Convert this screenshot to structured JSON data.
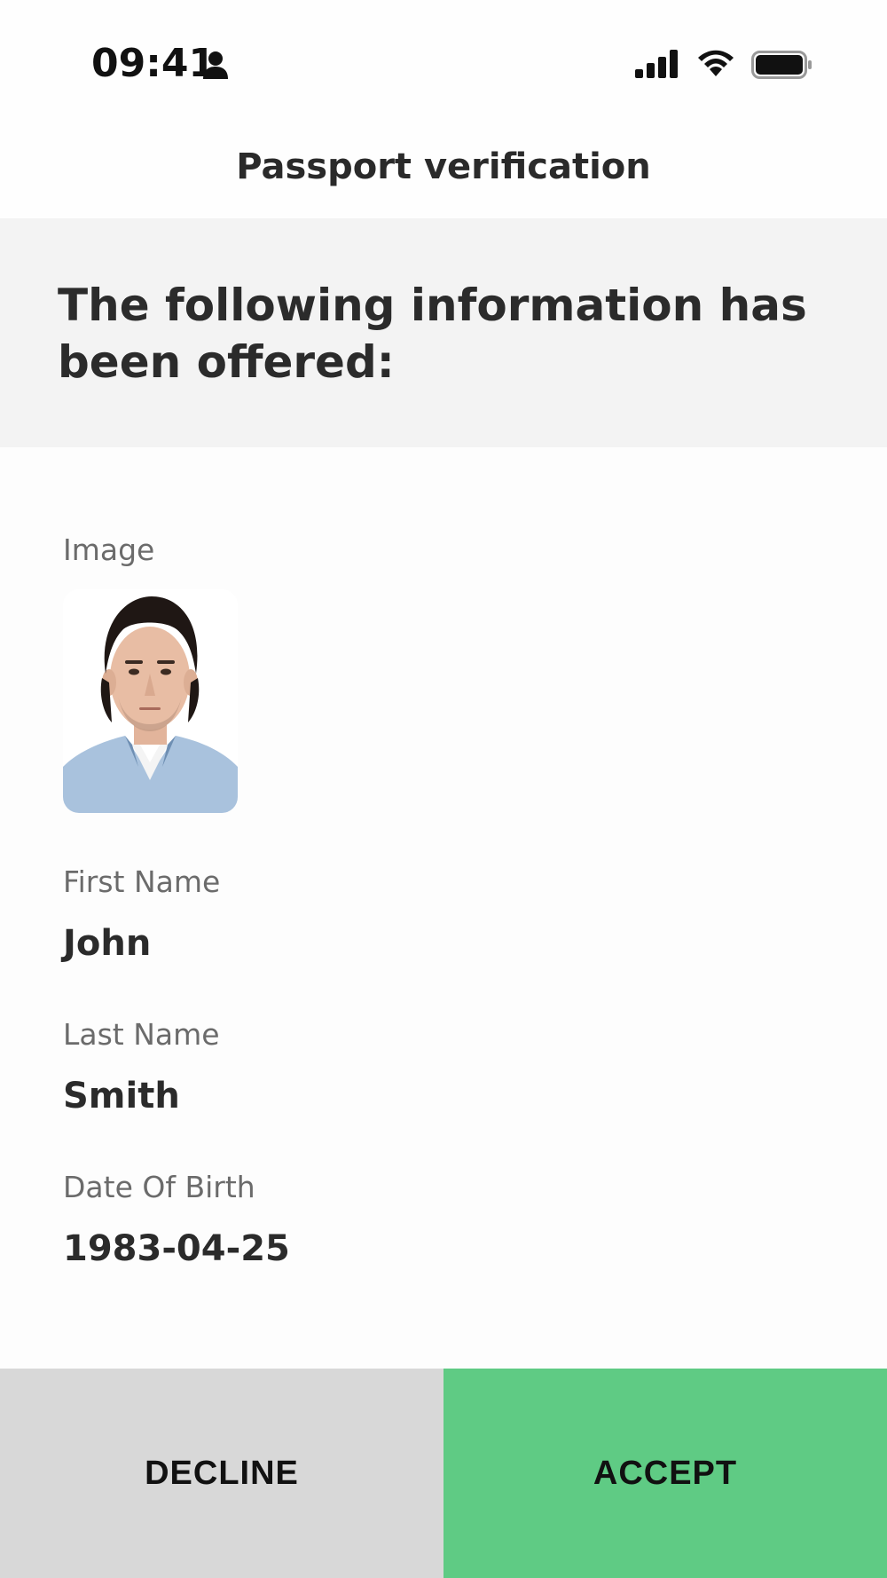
{
  "status_bar": {
    "time": "09:41",
    "icons": [
      "person-icon",
      "cellular-signal-icon",
      "wifi-icon",
      "battery-icon"
    ]
  },
  "nav": {
    "title": "Passport verification"
  },
  "banner": {
    "text": "The following information has been offered:"
  },
  "fields": {
    "image": {
      "label": "Image"
    },
    "first_name": {
      "label": "First Name",
      "value": "John"
    },
    "last_name": {
      "label": "Last Name",
      "value": "Smith"
    },
    "date_of_birth": {
      "label": "Date Of Birth",
      "value": "1983-04-25"
    }
  },
  "actions": {
    "decline_label": "DECLINE",
    "accept_label": "ACCEPT"
  },
  "colors": {
    "accept": "#5fcb84",
    "decline": "#d8d8d8",
    "banner_bg": "#f3f3f3",
    "text": "#2b2b2b",
    "label": "#6b6b6b"
  }
}
